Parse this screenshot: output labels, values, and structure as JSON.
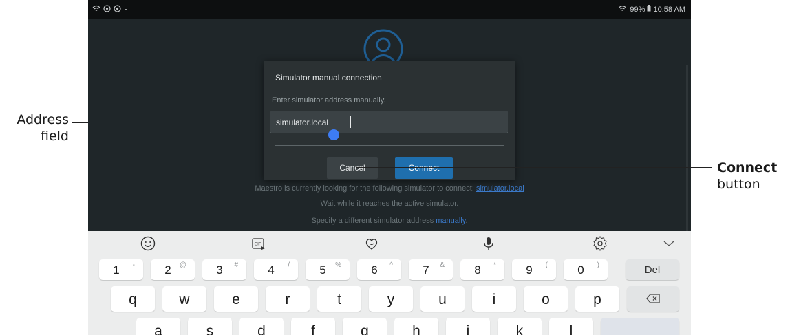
{
  "callouts": {
    "address_line1": "Address",
    "address_line2": "field",
    "connect_bold": "Connect",
    "connect_rest": "button"
  },
  "status_bar": {
    "left_icons": [
      "wifi-signal-icon",
      "app-notification-icon",
      "app-notification-icon",
      "dot-icon"
    ],
    "battery": "99%",
    "time": "10:58 AM"
  },
  "app": {
    "line1_prefix": "Maestro is currently looking for the following simulator to connect:",
    "line1_link": "simulator.local",
    "line2": "Wait while it reaches the active simulator.",
    "line3_prefix": "Specify a different simulator address",
    "line3_link": "manually",
    "line3_suffix": "."
  },
  "dialog": {
    "title": "Simulator manual connection",
    "description": "Enter simulator address manually.",
    "address_value": "simulator.local",
    "cancel_label": "Cancel",
    "connect_label": "Connect"
  },
  "keyboard": {
    "toolbar": [
      "emoji-icon",
      "gif-icon",
      "sticker-icon",
      "mic-icon",
      "settings-icon",
      "collapse-chevron-icon"
    ],
    "number_row": [
      {
        "main": "1",
        "sup": "-"
      },
      {
        "main": "2",
        "sup": "@"
      },
      {
        "main": "3",
        "sup": "#"
      },
      {
        "main": "4",
        "sup": "/"
      },
      {
        "main": "5",
        "sup": "%"
      },
      {
        "main": "6",
        "sup": "^"
      },
      {
        "main": "7",
        "sup": "&"
      },
      {
        "main": "8",
        "sup": "*"
      },
      {
        "main": "9",
        "sup": "("
      },
      {
        "main": "0",
        "sup": ")"
      }
    ],
    "del_label": "Del",
    "letter_row1": [
      "q",
      "w",
      "e",
      "r",
      "t",
      "y",
      "u",
      "i",
      "o",
      "p"
    ],
    "letter_row2": [
      "a",
      "s",
      "d",
      "f",
      "g",
      "h",
      "j",
      "k",
      "l"
    ]
  }
}
